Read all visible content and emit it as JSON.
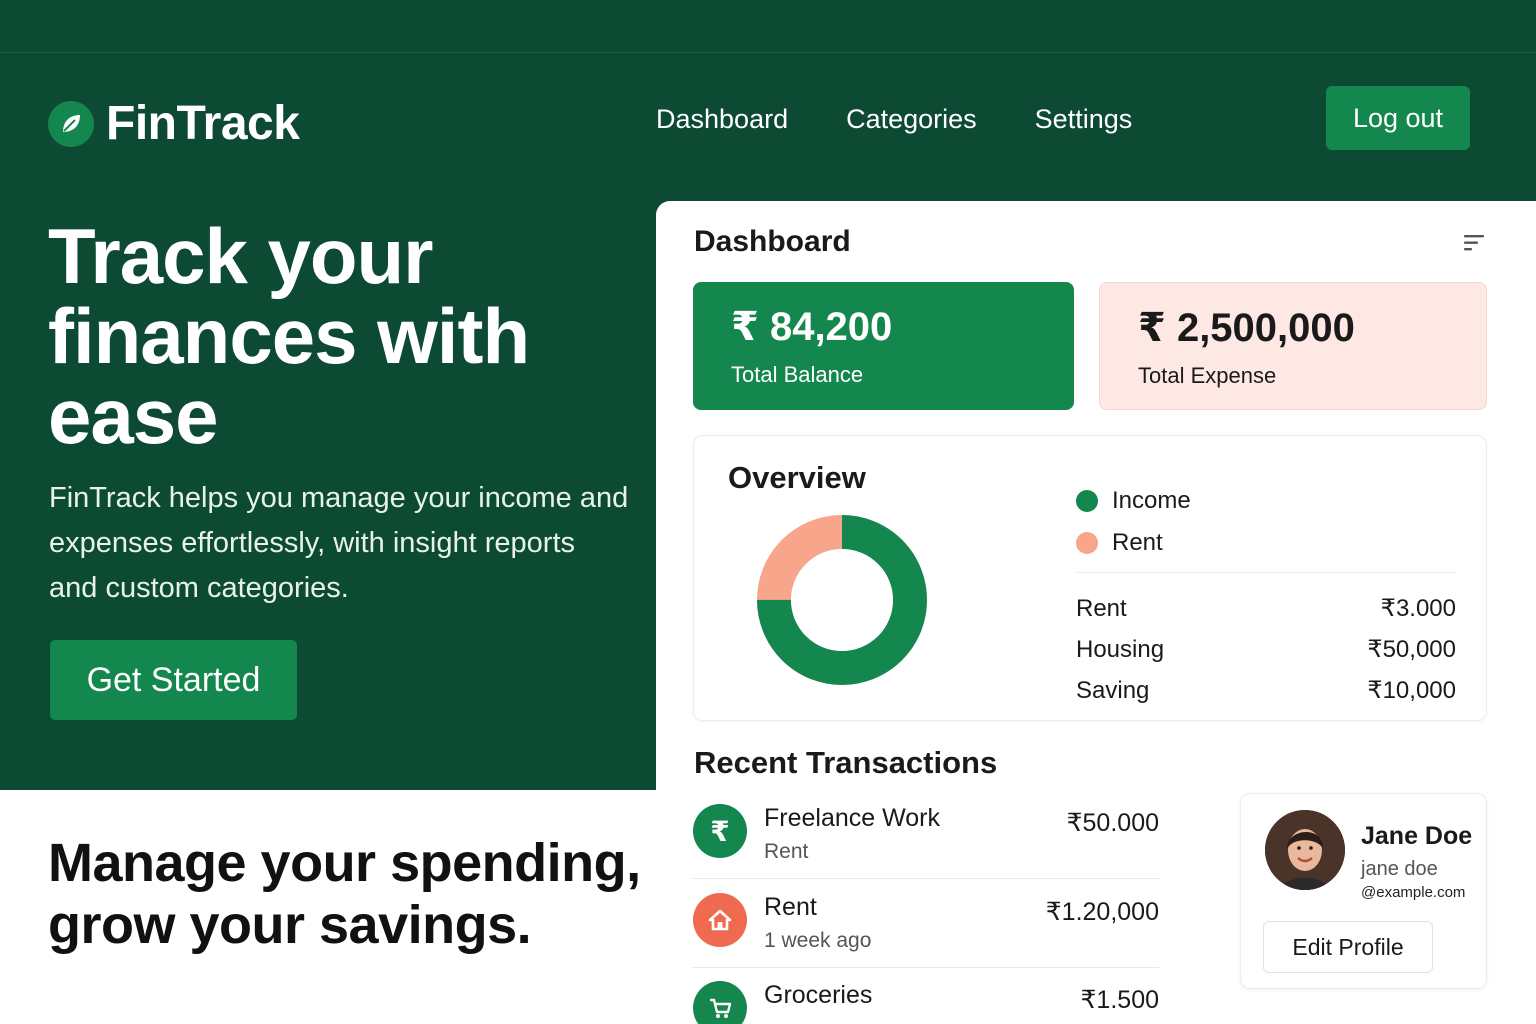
{
  "brand": {
    "name": "FinTrack",
    "icon": "leaf-icon"
  },
  "nav": {
    "items": [
      "Dashboard",
      "Categories",
      "Settings"
    ],
    "logout_label": "Log out"
  },
  "hero": {
    "title": "Track your finances with ease",
    "subtitle": "FinTrack helps you manage your income and expenses effortlessly, with insight reports and custom categories.",
    "cta_label": "Get Started"
  },
  "lower": {
    "title": "Manage your spending, grow your savings."
  },
  "dashboard": {
    "title": "Dashboard",
    "menu_icon": "filter-lines-icon",
    "balance": {
      "value": "₹ 84,200",
      "label": "Total Balance"
    },
    "expense": {
      "value": "₹ 2,500,000",
      "label": "Total Expense"
    },
    "overview": {
      "title": "Overview",
      "legend": [
        {
          "label": "Income",
          "color": "#14874f"
        },
        {
          "label": "Rent",
          "color": "#f7a58b"
        }
      ],
      "rows": [
        {
          "label": "Rent",
          "amount": "₹3.000"
        },
        {
          "label": "Housing",
          "amount": "₹50,000"
        },
        {
          "label": "Saving",
          "amount": "₹10,000"
        }
      ]
    },
    "transactions": {
      "title": "Recent Transactions",
      "items": [
        {
          "name": "Freelance Work",
          "sub": "Rent",
          "amount": "₹50.000",
          "icon": "rupee-icon",
          "color": "#14874f"
        },
        {
          "name": "Rent",
          "sub": "1 week ago",
          "amount": "₹1.20,000",
          "icon": "house-icon",
          "color": "#ef6a4e"
        },
        {
          "name": "Groceries",
          "sub": "",
          "amount": "₹1.500",
          "icon": "cart-icon",
          "color": "#14874f"
        }
      ]
    },
    "profile": {
      "name": "Jane Doe",
      "handle": "jane doe",
      "email": "@example.com",
      "edit_label": "Edit Profile"
    }
  },
  "colors": {
    "brand_dark": "#0c4a33",
    "accent": "#14874f",
    "rent_slice": "#f7a58b",
    "expense_bg": "#fde8e4"
  }
}
